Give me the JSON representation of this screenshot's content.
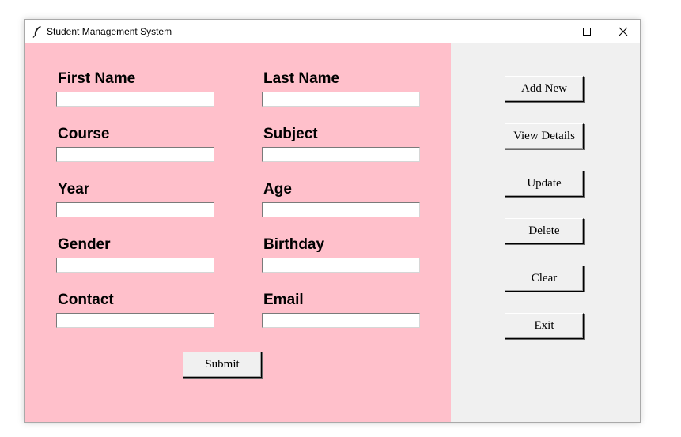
{
  "window": {
    "title": "Student Management System",
    "controls": {
      "minimize_icon": "minimize-icon",
      "maximize_icon": "maximize-icon",
      "close_icon": "close-icon"
    }
  },
  "colors": {
    "form_background": "#ffc0cb",
    "side_background": "#f0f0f0"
  },
  "form": {
    "fields": [
      {
        "label": "First Name",
        "value": ""
      },
      {
        "label": "Last Name",
        "value": ""
      },
      {
        "label": "Course",
        "value": ""
      },
      {
        "label": "Subject",
        "value": ""
      },
      {
        "label": "Year",
        "value": ""
      },
      {
        "label": "Age",
        "value": ""
      },
      {
        "label": "Gender",
        "value": ""
      },
      {
        "label": "Birthday",
        "value": ""
      },
      {
        "label": "Contact",
        "value": ""
      },
      {
        "label": "Email",
        "value": ""
      }
    ],
    "submit_label": "Submit"
  },
  "actions": {
    "add_new": "Add New",
    "view_details": "View Details",
    "update": "Update",
    "delete": "Delete",
    "clear": "Clear",
    "exit": "Exit"
  }
}
